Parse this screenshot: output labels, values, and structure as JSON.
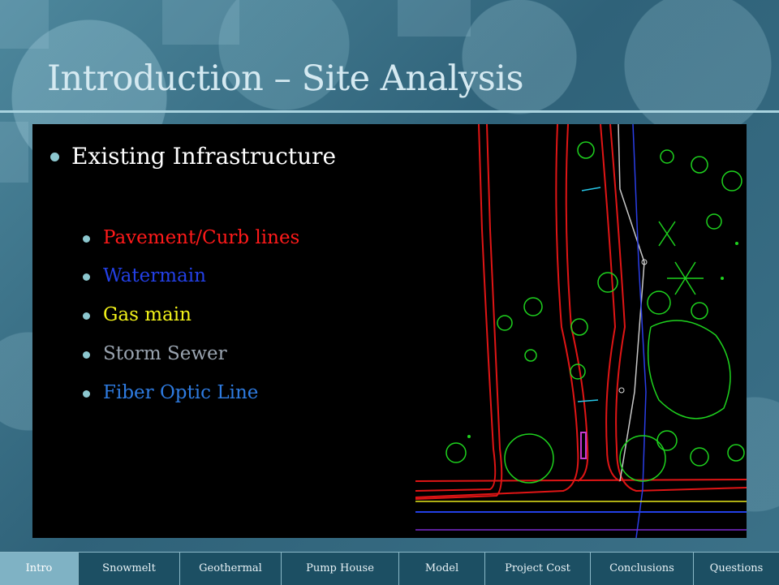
{
  "slide": {
    "title": "Introduction – Site Analysis",
    "main_bullet": "Existing Infrastructure",
    "sub_bullets": [
      {
        "label": "Pavement/Curb lines",
        "color": "#ff1a1a"
      },
      {
        "label": "Watermain",
        "color": "#2340e6"
      },
      {
        "label": "Gas main",
        "color": "#f2f21a"
      },
      {
        "label": "Storm Sewer",
        "color": "#9aa4b0"
      },
      {
        "label": "Fiber Optic Line",
        "color": "#2e7be0"
      }
    ]
  },
  "nav": {
    "items": [
      "Intro",
      "Snowmelt",
      "Geothermal",
      "Pump House",
      "Model",
      "Project Cost",
      "Conclusions",
      "Questions"
    ],
    "active": "Intro"
  },
  "colors": {
    "accent": "#8cc7cf",
    "title": "#d4e9f1",
    "nav_bg": "#1c4f63",
    "nav_active": "#7fb2c4"
  }
}
